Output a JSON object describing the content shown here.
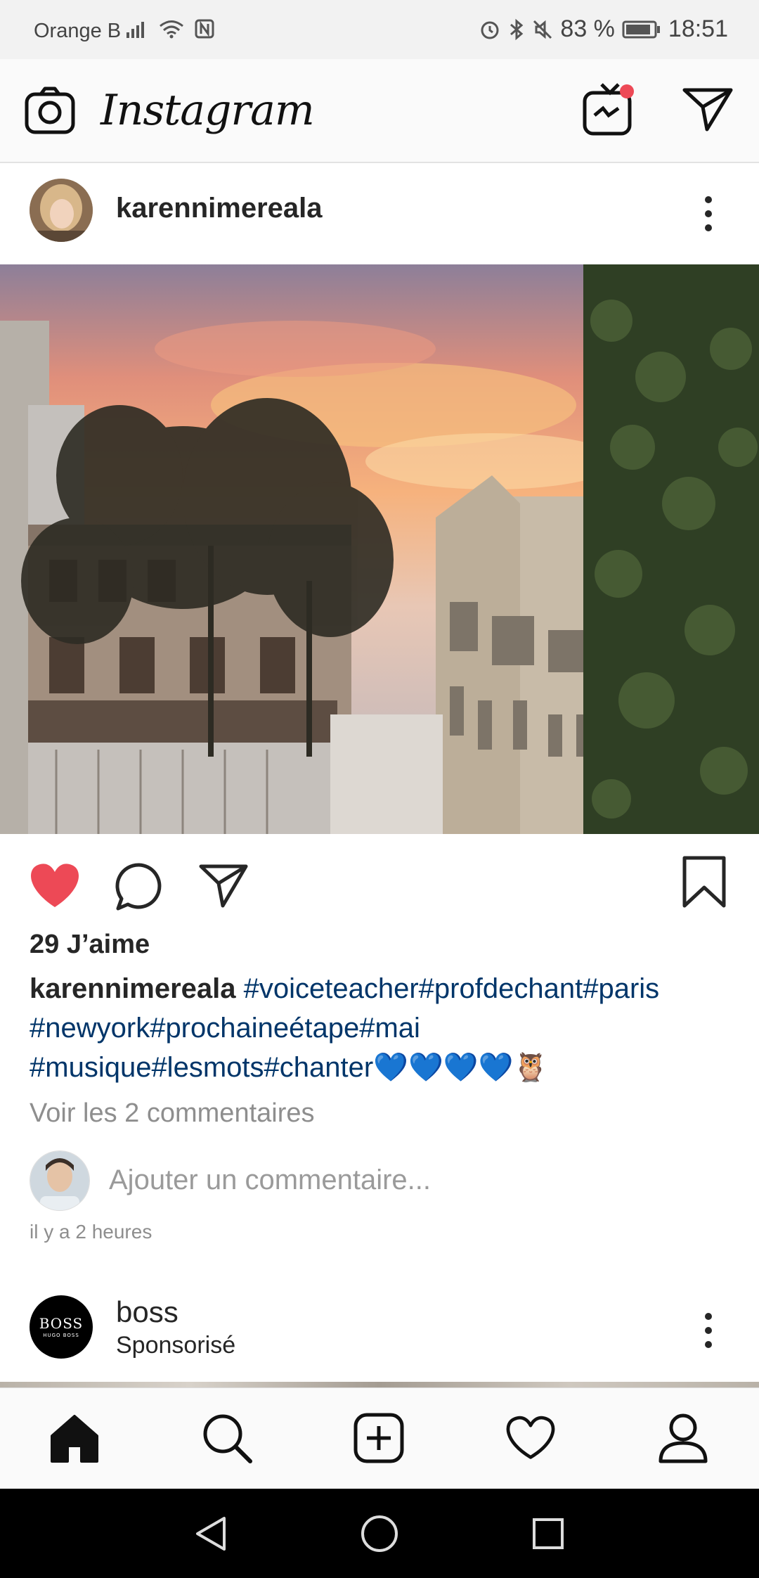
{
  "status": {
    "carrier": "Orange B",
    "battery": "83 %",
    "time": "18:51"
  },
  "app": {
    "logo": "Instagram"
  },
  "post": {
    "username": "karennimereala",
    "likes": "29 J’aime",
    "caption_user": "karennimereala",
    "caption_tags": "#voiceteacher#profdechant#paris #newyork#prochaineétape#mai #musique#lesmots#chanter💙💙💙💙🦉",
    "view_comments": "Voir les 2 commentaires",
    "comment_placeholder": "Ajouter un commentaire...",
    "timestamp": "il y a 2 heures",
    "liked": true
  },
  "post2": {
    "username": "boss",
    "sponsored": "Sponsorisé",
    "avatar_text": "BOSS",
    "avatar_subtext": "HUGO BOSS"
  },
  "colors": {
    "like": "#ed4956",
    "hashtag": "#003569",
    "notif": "#ed4956"
  },
  "icons": {
    "topbar": [
      "camera-icon",
      "igtv-icon",
      "direct-icon"
    ],
    "actions": [
      "heart-filled-icon",
      "comment-icon",
      "share-icon",
      "bookmark-icon"
    ],
    "bottom_nav": [
      "home-icon",
      "search-icon",
      "add-post-icon",
      "activity-heart-icon",
      "profile-icon"
    ],
    "system_nav": [
      "back-icon",
      "home-circle-icon",
      "recents-icon"
    ]
  }
}
